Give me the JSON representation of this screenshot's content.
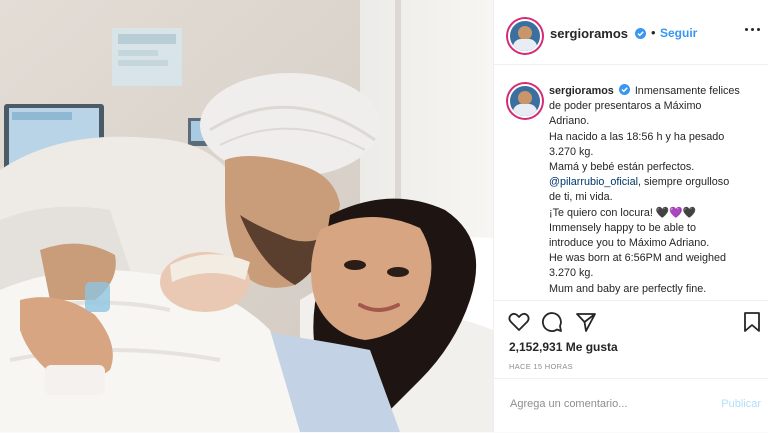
{
  "post": {
    "username": "sergioramos",
    "follow_label": "Seguir",
    "separator": "•",
    "caption_lines": [
      "Inmensamente felices",
      "de poder presentaros a Máximo",
      "Adriano.",
      "Ha nacido a las 18:56 h y ha pesado",
      "3.270 kg.",
      "Mamá y bebé están perfectos.",
      ", siempre orgulloso",
      "de ti, mi vida.",
      "¡Te quiero con locura! 🖤💜🖤",
      "Immensely happy to be able to",
      "introduce you to Máximo Adriano.",
      "He was born at 6:56PM and weighed",
      "3.270 kg.",
      "Mum and baby are perfectly fine."
    ],
    "mention": "@pilarrubio_oficial",
    "likes": "2,152,931 Me gusta",
    "time_ago": "HACE 15 HORAS",
    "comment_placeholder": "Agrega un comentario...",
    "publish_label": "Publicar",
    "icons": [
      "heart-icon",
      "comment-icon",
      "share-icon",
      "bookmark-icon",
      "more-options-icon",
      "verified-icon"
    ],
    "colors": {
      "link": "#3897f0",
      "text": "#262626",
      "muted": "#8e8e8e",
      "publish_disabled": "#b2dffc",
      "story_ring": "#d62976",
      "mention": "#00376b"
    }
  }
}
